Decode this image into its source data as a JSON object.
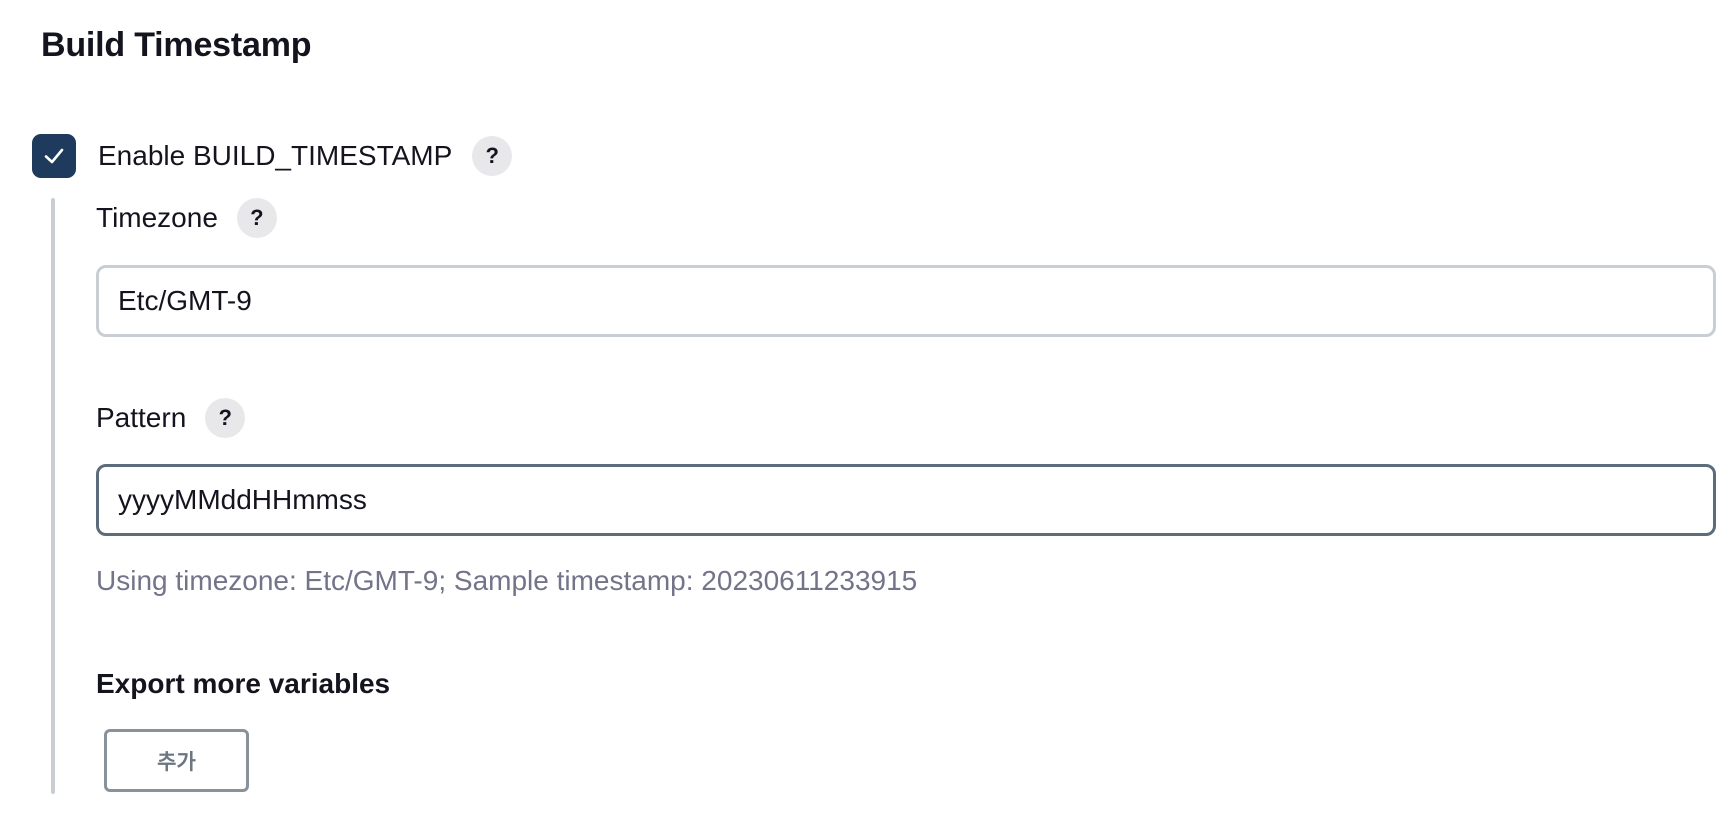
{
  "section": {
    "title": "Build Timestamp"
  },
  "enable": {
    "label": "Enable BUILD_TIMESTAMP",
    "checked": true,
    "help_label": "?"
  },
  "timezone": {
    "label": "Timezone",
    "value": "Etc/GMT-9",
    "help_label": "?"
  },
  "pattern": {
    "label": "Pattern",
    "value": "yyyyMMddHHmmss",
    "help_label": "?"
  },
  "hint": {
    "text": "Using timezone: Etc/GMT-9; Sample timestamp: 20230611233915"
  },
  "export": {
    "heading": "Export more variables",
    "add_label": "추가"
  },
  "colors": {
    "checkbox": "#1e3a5c",
    "input_border": "#c9ced4",
    "input_border_focused": "#5d6c7b",
    "hint_text": "#737389",
    "help_bg": "#e8e8eb"
  }
}
